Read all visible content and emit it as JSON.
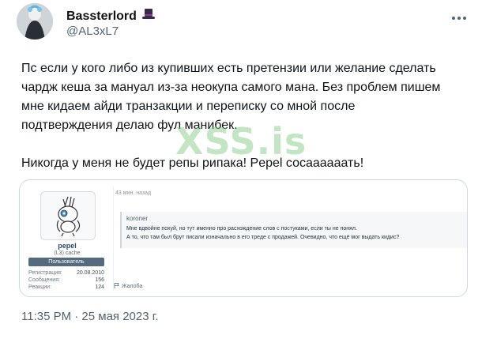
{
  "author": {
    "display_name": "Bassterlord",
    "handle": "@AL3xL7"
  },
  "tweet": {
    "text": "Пс если у кого либо из купивших есть претензии или желание сделать\nчардж кеша за мануал из-за неокупа самого мана. Без проблем пишем\nмне кидаем айди транзакции и переписку со мной после\nподтверждения делаю фул манибек.\n\nНикогда у меня не будет репы рипака!  Pepel сосаааааать!",
    "timestamp": "11:35 PM · 25 мая 2023 г."
  },
  "watermark": "XSS.is",
  "screenshot_media": {
    "post_time": "43 мин. назад",
    "user": {
      "username": "pepel",
      "rank": "(L3) cache",
      "badge": "Пользователь",
      "stats": [
        {
          "label": "Регистрация:",
          "value": "20.08.2010"
        },
        {
          "label": "Сообщения:",
          "value": "156"
        },
        {
          "label": "Реакции:",
          "value": "124"
        }
      ]
    },
    "quote": {
      "author": "koroner",
      "line1": "Мне вдвойне похуй, но тут именно про расхождение слов с постуками, если ты не понял.",
      "line2": "А то, что там был брут писали изначально в его треде с продажей. Очевидно, что ещё мог выдать кидис?"
    },
    "report_label": "Жалоба"
  },
  "icons": {
    "hat": "top-hat-icon",
    "more": "more-options-icon",
    "report": "flag-icon"
  },
  "colors": {
    "text_primary": "#0f1419",
    "text_secondary": "#536471",
    "watermark": "#78c878",
    "forum_badge": "#546a7f"
  }
}
